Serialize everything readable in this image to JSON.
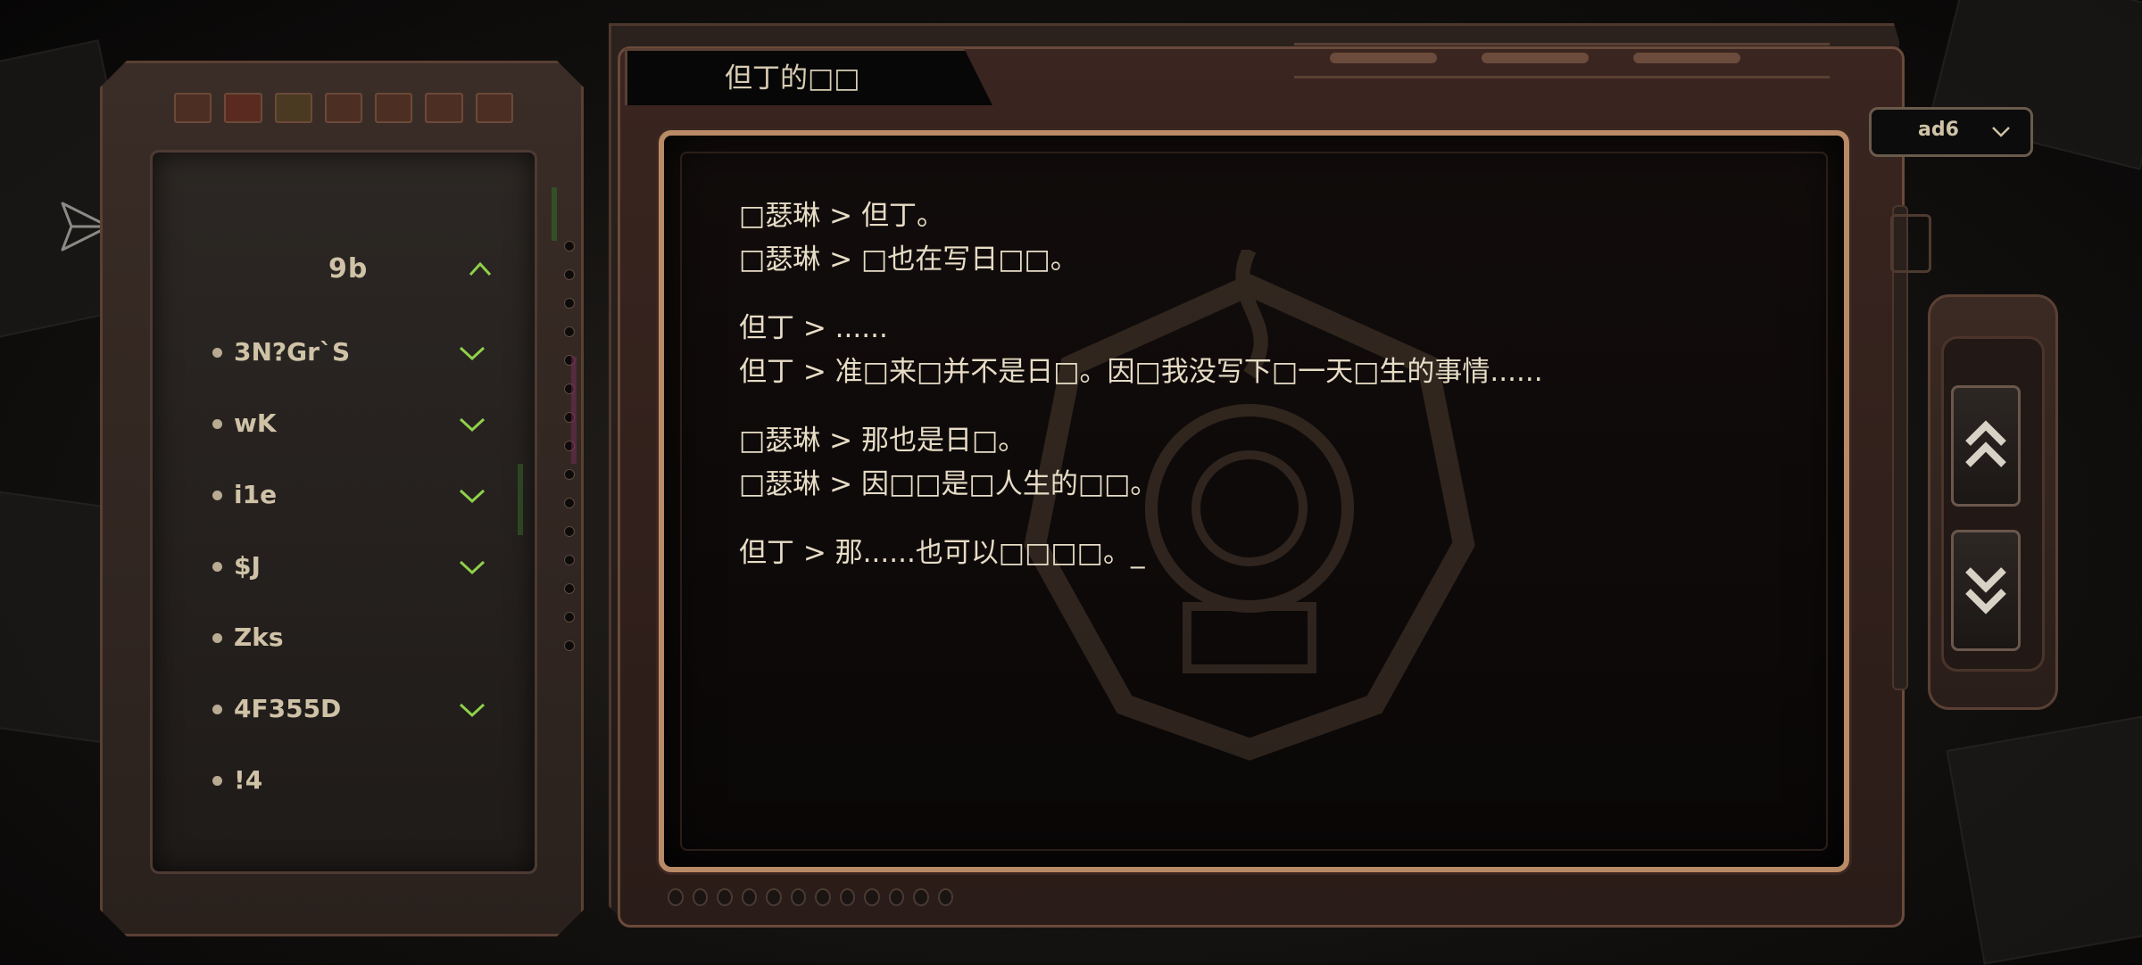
{
  "window": {
    "title": "但丁的□□"
  },
  "dropdown": {
    "value": "ad6"
  },
  "sidebar": {
    "chapter": {
      "label": "9b",
      "icon": "chevron-up-icon",
      "expanded": true
    },
    "entries": [
      {
        "label": "3N?Gr`S",
        "checked": true
      },
      {
        "label": "wK",
        "checked": true
      },
      {
        "label": "i1e",
        "checked": true
      },
      {
        "label": "$J",
        "checked": true
      },
      {
        "label": "Zks",
        "checked": false
      },
      {
        "label": "4F355D",
        "checked": true
      },
      {
        "label": "!4",
        "checked": false
      }
    ]
  },
  "dialogue": [
    [
      "□瑟琳 > 但丁。",
      "□瑟琳 > □也在写日□□。"
    ],
    [
      "但丁 > ......",
      "但丁 > 准□来□并不是日□。因□我没写下□一天□生的事情......"
    ],
    [
      "□瑟琳 > 那也是日□。",
      "□瑟琳 > 因□□是□人生的□□。"
    ],
    [
      "但丁 > 那......也可以□□□□。_"
    ]
  ],
  "colors": {
    "accent_check": "#8fd14a",
    "frame": "#b98a66",
    "text": "#e7dcc5"
  },
  "icons": {
    "send": "send-icon",
    "scroll_up": "double-chevron-up-icon",
    "scroll_down": "double-chevron-down-icon",
    "dropdown": "chevron-down-icon"
  }
}
